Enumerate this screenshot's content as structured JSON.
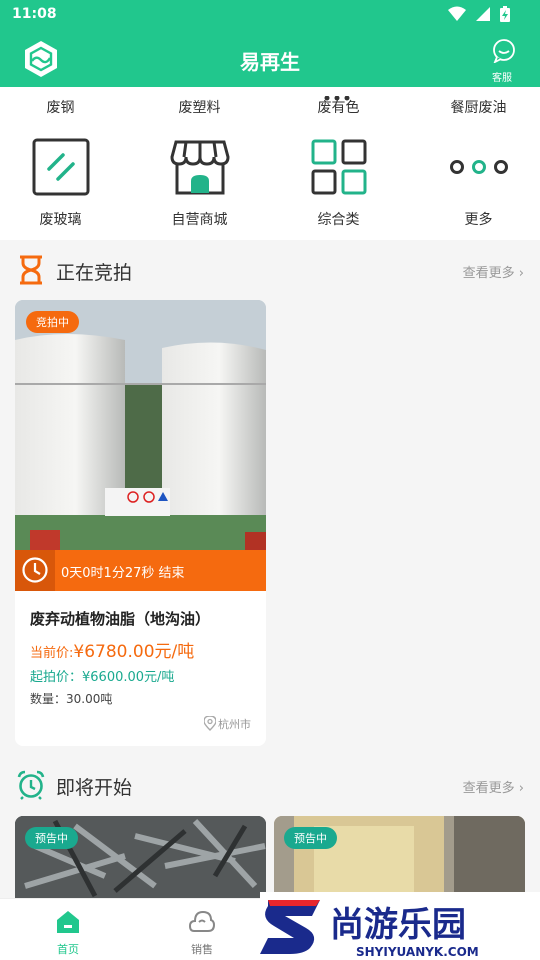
{
  "status_bar": {
    "time": "11:08"
  },
  "app_bar": {
    "title": "易再生",
    "service_label": "客服"
  },
  "categories_top": [
    "废钢",
    "废塑料",
    "废有色",
    "餐厨废油"
  ],
  "categories": [
    {
      "label": "废玻璃",
      "icon": "glass-icon"
    },
    {
      "label": "自营商城",
      "icon": "store-icon"
    },
    {
      "label": "综合类",
      "icon": "grid-icon"
    },
    {
      "label": "更多",
      "icon": "more-icon"
    }
  ],
  "auction_section": {
    "title": "正在竞拍",
    "more": "查看更多"
  },
  "auction_card": {
    "badge": "竞拍中",
    "countdown": "0天0时1分27秒 结束",
    "title": "废弃动植物油脂（地沟油）",
    "current_price_label": "当前价:",
    "current_price": "¥6780.00元/吨",
    "start_price": "起拍价：¥6600.00元/吨",
    "quantity": "数量：30.00吨",
    "location": "杭州市"
  },
  "upcoming_section": {
    "title": "即将开始",
    "more": "查看更多"
  },
  "upcoming_badges": [
    "预告中",
    "预告中"
  ],
  "bottom_nav": [
    "首页",
    "销售"
  ],
  "watermark": {
    "title": "尚游乐园",
    "url": "SHYIYUANYK.COM"
  },
  "colors": {
    "brand": "#21c78d",
    "accent": "#f56a0f",
    "teal": "#1aa98f",
    "watermark": "#1a2a8c"
  }
}
